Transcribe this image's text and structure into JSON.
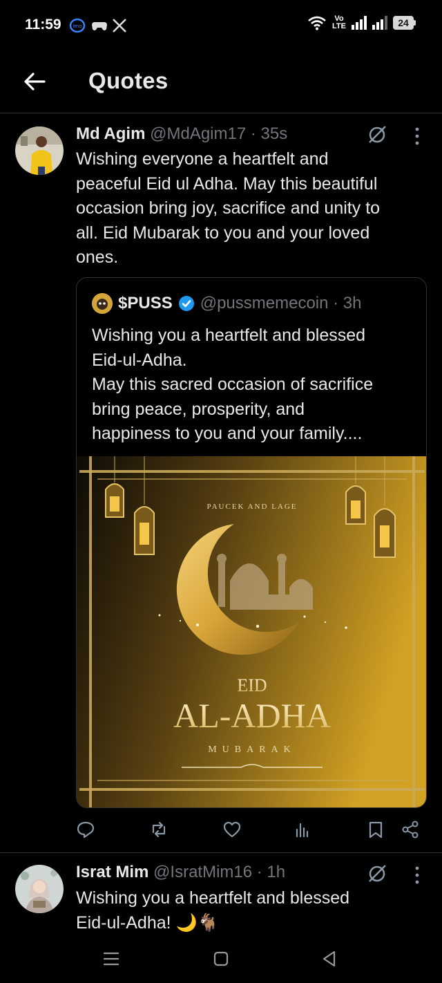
{
  "status_bar": {
    "time": "11:59",
    "volte_top": "Vo",
    "volte_bottom": "LTE",
    "battery": "24",
    "icons": [
      "imo-icon",
      "game-controller-icon",
      "x-logo-icon",
      "wifi-icon",
      "signal-icon",
      "battery-icon"
    ]
  },
  "header": {
    "title": "Quotes",
    "back_icon": "arrow-left-icon"
  },
  "tweet1": {
    "name": "Md Agim",
    "handle": "@MdAgim17 · 35s",
    "text_lines": [
      "Wishing everyone a heartfelt and",
      "peaceful Eid ul Adha. May this beautiful",
      "occasion bring joy, sacrifice and unity to",
      "all. Eid Mubarak to you and your loved",
      "ones."
    ],
    "quote": {
      "name": "$PUSS",
      "handle": "@pussmemecoin · 3h",
      "verified": true,
      "text_lines": [
        "Wishing you a heartfelt and blessed",
        "Eid-ul-Adha.",
        "May this sacred occasion of sacrifice",
        "bring peace, prosperity, and",
        "happiness to you and your family...."
      ],
      "image": {
        "top_text": "PAUCEK AND LAGE",
        "eid": "EID",
        "title": "AL-ADHA",
        "subtitle": "MUBARAK"
      }
    },
    "actions": [
      "reply-icon",
      "retweet-icon",
      "like-icon",
      "views-icon",
      "bookmark-icon",
      "share-icon"
    ]
  },
  "tweet2": {
    "name": "Israt Mim",
    "handle": "@IsratMim16 · 1h",
    "text_lines": [
      "Wishing you a heartfelt and blessed",
      "Eid-ul-Adha! 🌙🐐"
    ]
  },
  "colors": {
    "background": "#000000",
    "text": "#e7e9ea",
    "muted": "#71767b",
    "border": "#2f3336",
    "verified": "#1d9bf0",
    "gold": "#c9a227"
  }
}
